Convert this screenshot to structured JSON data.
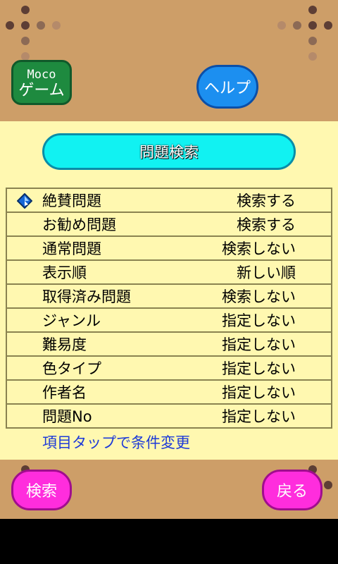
{
  "header": {
    "moco_line1": "Moco",
    "moco_line2": "ゲーム",
    "help_label": "ヘルプ"
  },
  "title": "問題検索",
  "conditions": [
    {
      "label": "絶賛問題",
      "value": "検索する"
    },
    {
      "label": "お勧め問題",
      "value": "検索する"
    },
    {
      "label": "通常問題",
      "value": "検索しない"
    },
    {
      "label": "表示順",
      "value": "新しい順"
    },
    {
      "label": "取得済み問題",
      "value": "検索しない"
    },
    {
      "label": "ジャンル",
      "value": "指定しない"
    },
    {
      "label": "難易度",
      "value": "指定しない"
    },
    {
      "label": "色タイプ",
      "value": "指定しない"
    },
    {
      "label": "作者名",
      "value": "指定しない"
    },
    {
      "label": "問題No",
      "value": "指定しない"
    }
  ],
  "hint": "項目タップで条件変更",
  "footer": {
    "search_label": "検索",
    "back_label": "戻る"
  },
  "colors": {
    "board": "#cd9e68",
    "panel": "#fff8b0",
    "title_pill": "#11f2f2",
    "help_button": "#1c8ff0",
    "moco_button": "#1e8a3f",
    "footer_buttons": "#ff2ddd",
    "hint_text": "#1d3ad8"
  }
}
